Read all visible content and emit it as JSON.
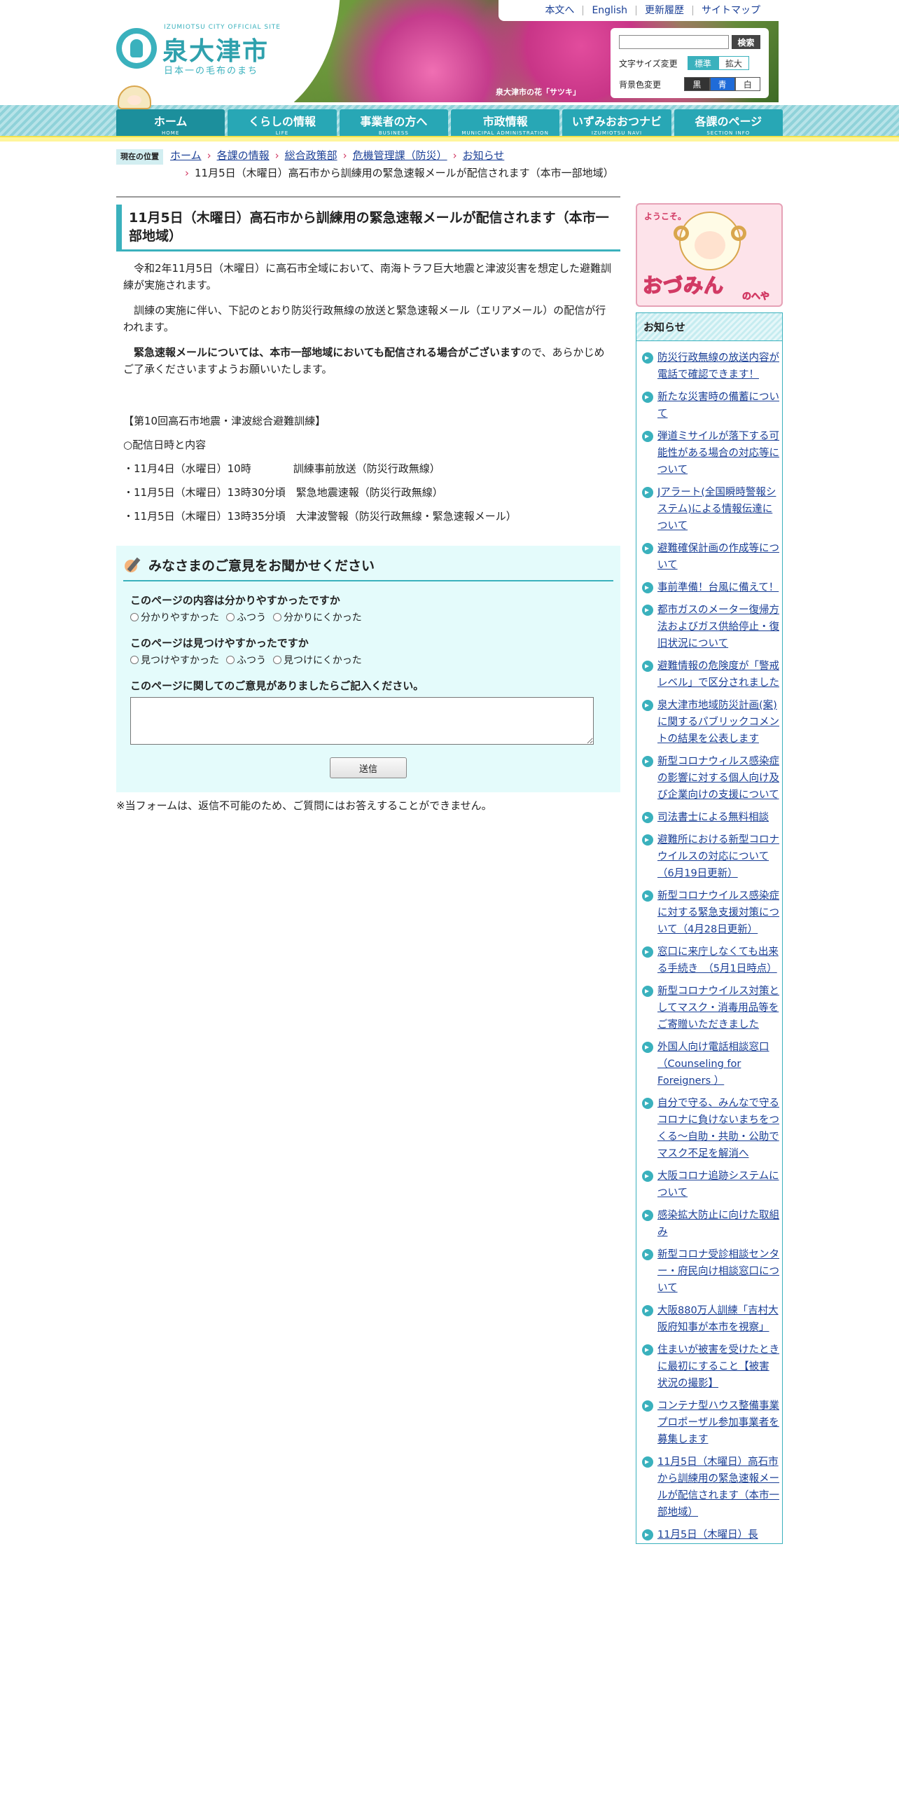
{
  "logo": {
    "subtitle": "IZUMIOTSU CITY OFFICIAL SITE",
    "name": "泉大津市",
    "tagline": "日本一の毛布のまち"
  },
  "hero": {
    "caption": "泉大津市の花「サツキ」"
  },
  "toplinks": [
    "本文へ",
    "English",
    "更新履歴",
    "サイトマップ"
  ],
  "tools": {
    "search_placeholder": "",
    "search_button": "検索",
    "font_size_label": "文字サイズ変更",
    "font_standard": "標準",
    "font_large": "拡大",
    "bg_label": "背景色変更",
    "bg_black": "黒",
    "bg_blue": "青",
    "bg_white": "白"
  },
  "nav": [
    {
      "jp": "ホーム",
      "en": "HOME"
    },
    {
      "jp": "くらしの情報",
      "en": "LIFE"
    },
    {
      "jp": "事業者の方へ",
      "en": "BUSINESS"
    },
    {
      "jp": "市政情報",
      "en": "MUNICIPAL ADMINISTRATION"
    },
    {
      "jp": "いずみおおつナビ",
      "en": "IZUMIOTSU NAVI"
    },
    {
      "jp": "各課のページ",
      "en": "SECTION INFO"
    }
  ],
  "breadcrumb": {
    "label": "現在の位置",
    "links": [
      "ホーム",
      "各課の情報",
      "総合政策部",
      "危機管理課（防災）",
      "お知らせ"
    ],
    "current": "11月5日（木曜日）高石市から訓練用の緊急速報メールが配信されます（本市一部地域）"
  },
  "article": {
    "title": "11月5日（木曜日）高石市から訓練用の緊急速報メールが配信されます（本市一部地域）",
    "p1": "　令和2年11月5日（木曜日）に高石市全域において、南海トラフ巨大地震と津波災害を想定した避難訓練が実施されます。",
    "p2": "　訓練の実施に伴い、下記のとおり防災行政無線の放送と緊急速報メール（エリアメール）の配信が行われます。",
    "p3_bold": "　緊急速報メールについては、本市一部地域においても配信される場合がございます",
    "p3_rest": "ので、あらかじめご了承くださいますようお願いいたします。",
    "line_heading": "【第10回高石市地震・津波総合避難訓練】",
    "line_sub": "○配信日時と内容",
    "schedule": [
      "・11月4日（水曜日）10時　　　　訓練事前放送（防災行政無線）",
      "・11月5日（木曜日）13時30分頃　緊急地震速報（防災行政無線）",
      "・11月5日（木曜日）13時35分頃　大津波警報（防災行政無線・緊急速報メール）"
    ]
  },
  "feedback": {
    "title": "みなさまのご意見をお聞かせください",
    "q1": "このページの内容は分かりやすかったですか",
    "q1_opts": [
      "分かりやすかった",
      "ふつう",
      "分かりにくかった"
    ],
    "q2": "このページは見つけやすかったですか",
    "q2_opts": [
      "見つけやすかった",
      "ふつう",
      "見つけにくかった"
    ],
    "q3": "このページに関してのご意見がありましたらご記入ください。",
    "submit": "送信",
    "note": "※当フォームは、返信不可能のため、ご質問にはお答えすることができません。"
  },
  "sidebar": {
    "banner_top": "ようこそ。",
    "banner_big": "おづみん",
    "banner_sub": "のへや",
    "news_title": "お知らせ",
    "news": [
      "防災行政無線の放送内容が電話で確認できます！",
      "新たな災害時の備蓄について",
      "弾道ミサイルが落下する可能性がある場合の対応等について",
      "Jアラート(全国瞬時警報システム)による情報伝達について",
      "避難確保計画の作成等について",
      "事前準備！台風に備えて！",
      "都市ガスのメーター復帰方法およびガス供給停止・復旧状況について",
      "避難情報の危険度が「警戒レベル」で区分されました",
      "泉大津市地域防災計画(案)に関するパブリックコメントの結果を公表します",
      "新型コロナウィルス感染症の影響に対する個人向け及び企業向けの支援について",
      "司法書士による無料相談",
      "避難所における新型コロナウイルスの対応について（6月19日更新）",
      "新型コロナウイルス感染症に対する緊急支援対策について（4月28日更新）",
      "窓口に来庁しなくても出来る手続き　（5月1日時点）",
      "新型コロナウイルス対策としてマスク・消毒用品等をご寄贈いただきました",
      "外国人向け電話相談窓口（Counseling for Foreigners ）",
      "自分で守る、みんなで守るコロナに負けないまちをつくる～自助・共助・公助でマスク不足を解消へ",
      "大阪コロナ追跡システムについて",
      "感染拡大防止に向けた取組み",
      "新型コロナ受診相談センター・府民向け相談窓口について",
      "大阪880万人訓練「吉村大阪府知事が本市を視察」",
      "住まいが被害を受けたときに最初にすること【被害状況の撮影】",
      "コンテナ型ハウス整備事業プロポーザル参加事業者を募集します",
      "11月5日（木曜日）高石市から訓練用の緊急速報メールが配信されます（本市一部地域）",
      "11月5日（木曜日）長"
    ]
  }
}
